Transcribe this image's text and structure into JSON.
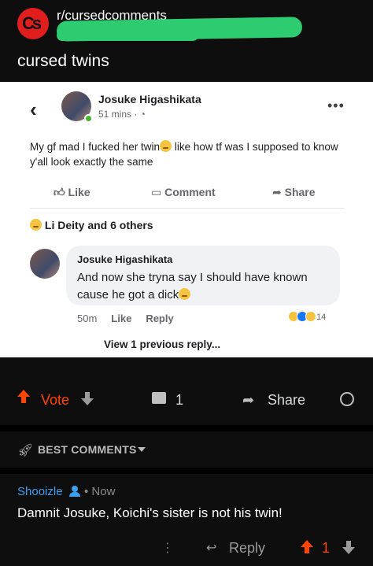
{
  "header": {
    "subreddit": "r/cursedcomments",
    "subreddit_icon_text": "Cs",
    "post_title": "cursed twins"
  },
  "embedded_post": {
    "author": "Josuke Higashikata",
    "time": "51 mins · ",
    "text_part1": "My gf mad I fucked her twin",
    "text_part2": " like how tf was I supposed to know y'all look exactly the same",
    "actions": {
      "like": "Like",
      "comment": "Comment",
      "share": "Share"
    },
    "reactions_summary": "Li Deity and 6 others",
    "comment": {
      "author": "Josuke Higashikata",
      "text": "And now she tryna say I should have known cause he got a dick",
      "time": "50m",
      "like": "Like",
      "reply": "Reply",
      "reaction_count": "14"
    },
    "view_previous": "View 1 previous reply..."
  },
  "vote_bar": {
    "vote_label": "Vote",
    "comment_count": "1",
    "share_label": "Share"
  },
  "best_comments": {
    "label": "BEST COMMENTS"
  },
  "top_comment": {
    "user": "Shooizle",
    "time": "• Now",
    "body": "Damnit Josuke, Koichi's sister is not his twin!",
    "reply_label": "Reply",
    "score": "1"
  },
  "colors": {
    "accent": "#ff4500",
    "username": "#3a9ff5",
    "background": "#0e0e0e"
  }
}
